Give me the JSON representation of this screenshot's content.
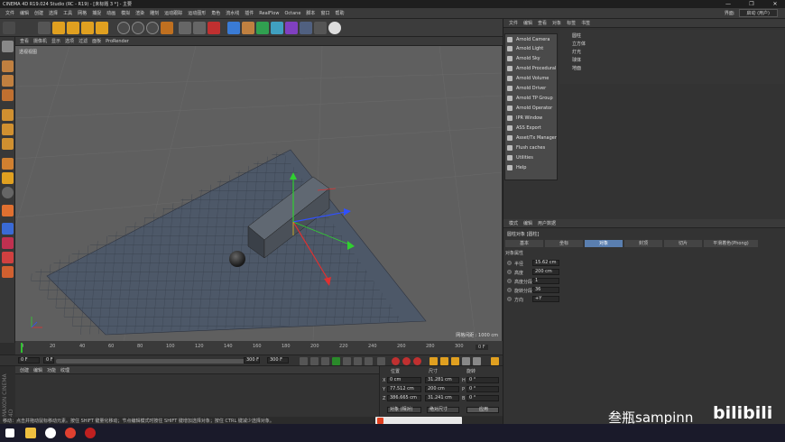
{
  "window": {
    "title": "CINEMA 4D R19.024 Studio (RC - R19) - [未标题 3 *] - 主要",
    "controls": [
      "—",
      "❐",
      "✕"
    ]
  },
  "menubar": [
    "文件",
    "编辑",
    "创建",
    "选择",
    "工具",
    "网格",
    "捕捉",
    "动画",
    "模拟",
    "渲染",
    "雕刻",
    "运动跟踪",
    "运动图形",
    "角色",
    "流水线",
    "插件",
    "RealFlow",
    "Octane",
    "脚本",
    "窗口",
    "帮助"
  ],
  "menubar_right": {
    "label": "界面:",
    "value": "启动 (用户)"
  },
  "viewport": {
    "menu": [
      "查看",
      "摄像机",
      "显示",
      "选项",
      "过滤",
      "面板",
      "ProRender"
    ],
    "label": "透视视图",
    "grid_info": "网格间距 : 1000 cm"
  },
  "timeline": {
    "ticks": [
      "0",
      "20",
      "40",
      "60",
      "80",
      "100",
      "120",
      "140",
      "160",
      "180",
      "200",
      "220",
      "240",
      "260",
      "280",
      "300"
    ],
    "frame_indicator": "0 F",
    "current_frame": "0 F",
    "start_field": "0 F",
    "end_field": "300 F",
    "end_field2": "300 F"
  },
  "material_manager": {
    "menu": [
      "创建",
      "编辑",
      "功能",
      "纹理"
    ]
  },
  "coordinates": {
    "headers": [
      "位置",
      "尺寸",
      "旋转"
    ],
    "rows": [
      {
        "axis": "X",
        "pos": "0 cm",
        "size": "31.281 cm",
        "rot_label": "H",
        "rot": "0 °"
      },
      {
        "axis": "Y",
        "pos": "77.512 cm",
        "size": "200 cm",
        "rot_label": "P",
        "rot": "0 °"
      },
      {
        "axis": "Z",
        "pos": "386.665 cm",
        "size": "31.241 cm",
        "rot_label": "B",
        "rot": "0 °"
      }
    ],
    "mode_left": "对象 (相对)",
    "mode_mid": "绝对尺寸",
    "apply": "应用"
  },
  "statusbar": "移动：点击并拖动鼠标移动元素。按住 SHIFT 键量化移动；节点编辑模式时按住 SHIFT 键增加选择对象；按住 CTRL 键减少选择对象。",
  "object_manager": {
    "menu": [
      "文件",
      "编辑",
      "查看",
      "对象",
      "标签",
      "书签"
    ],
    "objects": [
      "圆柱",
      "立方体",
      "灯光",
      "球体",
      "地面"
    ]
  },
  "arnold_menu": [
    "Arnold Camera",
    "Arnold Light",
    "Arnold Sky",
    "Arnold Procedural",
    "Arnold Volume",
    "Arnold Driver",
    "Arnold TP Group",
    "Arnold Operator",
    "IPR Window",
    "ASS Export",
    "Asset/Tx Manager",
    "Flush caches",
    "Utilities",
    "Help"
  ],
  "attributes": {
    "menu": [
      "模式",
      "编辑",
      "用户数据"
    ],
    "title": "圆柱对象 [圆柱]",
    "tabs": [
      "基本",
      "坐标",
      "对象",
      "封顶",
      "切片",
      "平滑着色(Phong)"
    ],
    "active_tab": "对象",
    "section": "对象属性",
    "fields": [
      {
        "label": "半径",
        "value": "15.62 cm"
      },
      {
        "label": "高度",
        "value": "200 cm"
      },
      {
        "label": "高度分段",
        "value": "1"
      },
      {
        "label": "旋转分段",
        "value": "36"
      },
      {
        "label": "方向",
        "value": "+Y"
      }
    ]
  },
  "watermark": "叁瓶sampinn",
  "brand": "bilibili",
  "maxon": "MAXON CINEMA 4D",
  "colors": {
    "axis_x": "#e03030",
    "axis_y": "#30d030",
    "axis_z": "#3050ff",
    "active_tab": "#5a7fb0"
  }
}
